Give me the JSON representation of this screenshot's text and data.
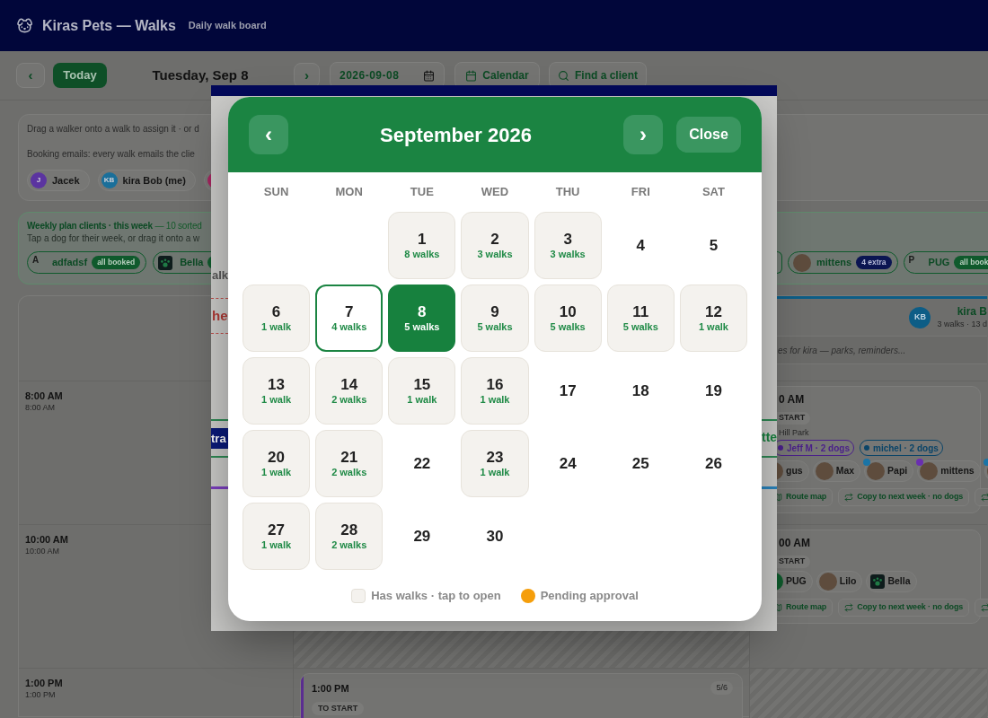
{
  "header": {
    "title": "Kiras Pets — Walks",
    "subtitle": "Daily walk board"
  },
  "toolbar": {
    "prev": "‹",
    "today": "Today",
    "date_title": "Tuesday, Sep 8",
    "next": "›",
    "date_value": "2026-09-08",
    "calendar": "Calendar",
    "find": "Find a client"
  },
  "info_card": {
    "hint": "Drag a walker onto a walk to assign it · or d",
    "emails": "Booking emails: every walk emails the clie",
    "walkers": [
      {
        "initials": "J",
        "name": "Jacek",
        "color": "#5b34a0"
      },
      {
        "initials": "KB",
        "name": "kira Bob (me)",
        "color": "#1a6f9a"
      },
      {
        "color": "#a3245e"
      }
    ]
  },
  "weekly_plan": {
    "title": "Weekly plan clients · this week",
    "count": "— 10 sorted",
    "hint": "Tap a dog for their week, or drag it onto a w",
    "clients": [
      {
        "kind": "letter",
        "initial": "A",
        "name": "adfadsf",
        "badge": {
          "kind": "booked",
          "text": "all booked"
        }
      },
      {
        "kind": "tile",
        "name": "Bella",
        "badge": {
          "kind": "booked"
        }
      }
    ],
    "more_clients": [
      {
        "kind": "photo",
        "name": "mittens",
        "badge": {
          "kind": "extra",
          "text": "4 extra"
        }
      },
      {
        "kind": "letter",
        "initial": "P",
        "name": "PUG",
        "badge": {
          "kind": "booked",
          "text": "all book"
        }
      }
    ]
  },
  "board": {
    "slots": [
      {
        "time": "8:00 AM",
        "sub": "8:00 AM"
      },
      {
        "time": "10:00 AM",
        "sub": "10:00 AM"
      },
      {
        "time": "1:00 PM",
        "sub": "1:00 PM"
      }
    ],
    "column": {
      "initials": "KB",
      "name": "kira B",
      "summary": "3 walks · 13 d",
      "notes_placeholder": "es for kira — parks, reminders..."
    },
    "column_walks": [
      {
        "time": "0 AM",
        "status": "START",
        "place": "Hill Park",
        "walkers": [
          {
            "name": "Jeff M · 2 dogs",
            "color": "#4a1f8a"
          },
          {
            "name": "michel · 2 dogs",
            "color": "#0a4468"
          }
        ],
        "dogs": [
          {
            "kind": "photo",
            "name": "gus"
          },
          {
            "kind": "photo",
            "name": "Max"
          },
          {
            "kind": "photo",
            "name": "Papi",
            "color": "#1a74a6"
          },
          {
            "kind": "photo",
            "name": "mittens",
            "color": "#6a2fb0"
          },
          {
            "kind": "photo",
            "color": "#1a74a6"
          }
        ],
        "actions": [
          {
            "kind": "map",
            "label": "Route map"
          },
          {
            "kind": "copy",
            "label": "Copy to next week · no dogs"
          },
          {
            "kind": "copy"
          }
        ]
      },
      {
        "time": "00 AM",
        "status": "START",
        "dogs": [
          {
            "kind": "avatar",
            "name": "PUG"
          },
          {
            "kind": "photo",
            "name": "Lilo"
          },
          {
            "kind": "tile",
            "name": "Bella"
          }
        ],
        "actions": [
          {
            "kind": "map",
            "label": "Route map"
          },
          {
            "kind": "copy",
            "label": "Copy to next week · no dogs"
          },
          {
            "kind": "copy"
          }
        ]
      }
    ],
    "afternoon_walk": {
      "time": "1:00 PM",
      "capacity": "5/6",
      "status": "TO START",
      "color": "#5b2d91"
    }
  },
  "backdrop": {
    "fragments": [
      {
        "kind": "label",
        "text": "alk"
      },
      {
        "kind": "alert",
        "text": "he"
      },
      {
        "kind": "badge",
        "text": "tra"
      },
      {
        "kind": "title",
        "text": "tte"
      }
    ]
  },
  "calendar": {
    "title": "September 2026",
    "prev": "‹",
    "next": "›",
    "close": "Close",
    "weekdays": [
      "SUN",
      "MON",
      "TUE",
      "WED",
      "THU",
      "FRI",
      "SAT"
    ],
    "weeks": [
      [
        {
          "day": "1",
          "walks": "8 walks",
          "selected": false,
          "today": false
        },
        {
          "day": "2",
          "walks": "3 walks",
          "selected": false,
          "today": false
        },
        {
          "day": "3",
          "walks": "3 walks",
          "selected": false,
          "today": false
        },
        {
          "day": "4",
          "selected": false,
          "today": false
        },
        {
          "day": "5",
          "selected": false,
          "today": false
        }
      ],
      [
        {
          "day": "6",
          "walks": "1 walk",
          "selected": false,
          "today": false
        },
        {
          "day": "7",
          "walks": "4 walks",
          "selected": false,
          "today": true
        },
        {
          "day": "8",
          "walks": "5 walks",
          "selected": true,
          "today": false
        },
        {
          "day": "9",
          "walks": "5 walks",
          "selected": false,
          "today": false
        },
        {
          "day": "10",
          "walks": "5 walks",
          "selected": false,
          "today": false
        },
        {
          "day": "11",
          "walks": "5 walks",
          "selected": false,
          "today": false
        },
        {
          "day": "12",
          "walks": "1 walk",
          "selected": false,
          "today": false
        }
      ],
      [
        {
          "day": "13",
          "walks": "1 walk",
          "selected": false,
          "today": false
        },
        {
          "day": "14",
          "walks": "2 walks",
          "selected": false,
          "today": false
        },
        {
          "day": "15",
          "walks": "1 walk",
          "selected": false,
          "today": false
        },
        {
          "day": "16",
          "walks": "1 walk",
          "selected": false,
          "today": false
        },
        {
          "day": "17",
          "selected": false,
          "today": false
        },
        {
          "day": "18",
          "selected": false,
          "today": false
        },
        {
          "day": "19",
          "selected": false,
          "today": false
        }
      ],
      [
        {
          "day": "20",
          "walks": "1 walk",
          "selected": false,
          "today": false
        },
        {
          "day": "21",
          "walks": "2 walks",
          "selected": false,
          "today": false
        },
        {
          "day": "22",
          "selected": false,
          "today": false
        },
        {
          "day": "23",
          "walks": "1 walk",
          "selected": false,
          "today": false
        },
        {
          "day": "24",
          "selected": false,
          "today": false
        },
        {
          "day": "25",
          "selected": false,
          "today": false
        },
        {
          "day": "26",
          "selected": false,
          "today": false
        }
      ],
      [
        {
          "day": "27",
          "walks": "1 walk",
          "selected": false,
          "today": false
        },
        {
          "day": "28",
          "walks": "2 walks",
          "selected": false,
          "today": false
        },
        {
          "day": "29",
          "selected": false,
          "today": false
        },
        {
          "day": "30",
          "selected": false,
          "today": false
        }
      ]
    ],
    "legend": [
      {
        "kind": "swatch",
        "label": "Has walks · tap to open"
      },
      {
        "kind": "dot",
        "label": "Pending approval"
      }
    ]
  }
}
